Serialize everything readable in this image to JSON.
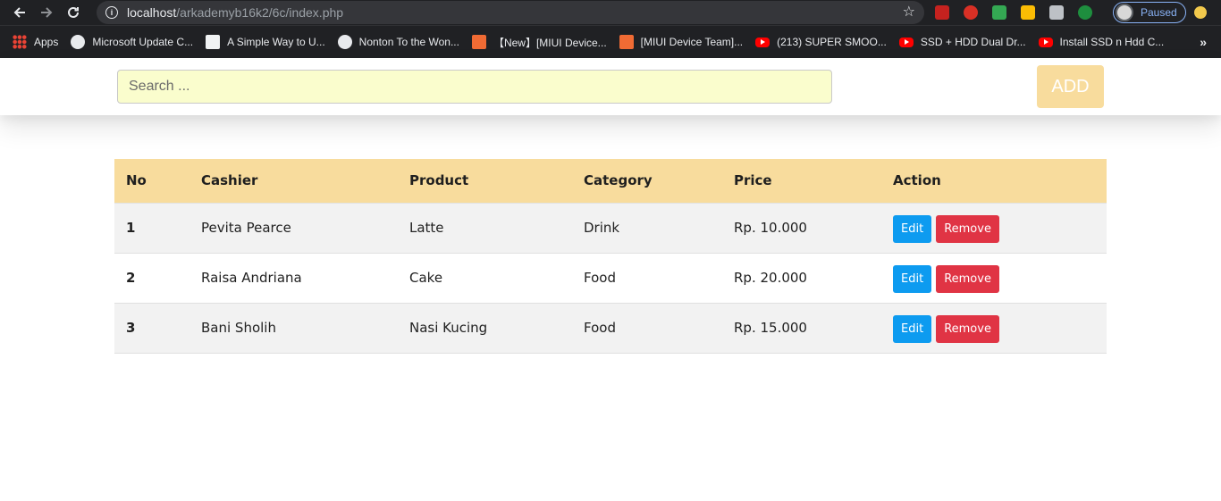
{
  "browser": {
    "url_host": "localhost",
    "url_path": "/arkademyb16k2/6c/index.php",
    "profile_status": "Paused",
    "bookmarks": [
      {
        "label": "Apps",
        "icon": "apps-icon"
      },
      {
        "label": "Microsoft Update C...",
        "icon": "globe-icon"
      },
      {
        "label": "A Simple Way to U...",
        "icon": "document-icon"
      },
      {
        "label": "Nonton To the Won...",
        "icon": "globe-icon"
      },
      {
        "label": "【New】[MIUI Device...",
        "icon": "miui-icon"
      },
      {
        "label": "[MIUI Device Team]...",
        "icon": "miui-icon"
      },
      {
        "label": "(213) SUPER SMOO...",
        "icon": "youtube-icon"
      },
      {
        "label": "SSD + HDD Dual Dr...",
        "icon": "youtube-icon"
      },
      {
        "label": "Install SSD n Hdd C...",
        "icon": "youtube-icon"
      }
    ]
  },
  "header": {
    "search_placeholder": "Search ...",
    "add_label": "ADD"
  },
  "table": {
    "columns": [
      "No",
      "Cashier",
      "Product",
      "Category",
      "Price",
      "Action"
    ],
    "rows": [
      {
        "no": "1",
        "cashier": "Pevita Pearce",
        "product": "Latte",
        "category": "Drink",
        "price": "Rp. 10.000"
      },
      {
        "no": "2",
        "cashier": "Raisa Andriana",
        "product": "Cake",
        "category": "Food",
        "price": "Rp. 20.000"
      },
      {
        "no": "3",
        "cashier": "Bani Sholih",
        "product": "Nasi Kucing",
        "category": "Food",
        "price": "Rp. 15.000"
      }
    ],
    "edit_label": "Edit",
    "remove_label": "Remove"
  },
  "colors": {
    "header_row": "#f8dc9d",
    "search_bg": "#fafdcd",
    "edit_button": "#0d9bf0",
    "remove_button": "#e03444"
  }
}
